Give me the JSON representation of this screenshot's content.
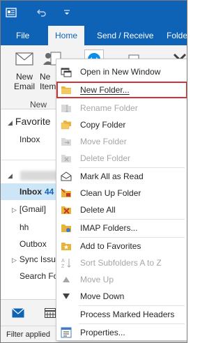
{
  "ribbon_tabs": [
    "File",
    "Home",
    "Send / Receive",
    "Folde"
  ],
  "ribbon_buttons": {
    "new_email_line1": "New",
    "new_email_line2": "Email",
    "new_items_line1": "Ne",
    "new_items_line2": "Item",
    "group_label": "New"
  },
  "nav": {
    "favorites_header": "Favorite",
    "favorites_inbox": "Inbox",
    "inbox_label": "Inbox",
    "inbox_count": "44",
    "gmail": "[Gmail]",
    "hh": "hh",
    "outbox": "Outbox",
    "sync_issues": "Sync Issue",
    "search_folders": "Search Fo"
  },
  "status_text": "Filter applied",
  "context_menu": {
    "items": [
      {
        "label": "Open in New Window",
        "enabled": true,
        "icon": "open-window-icon"
      },
      {
        "label": "New Folder...",
        "enabled": true,
        "icon": "new-folder-icon",
        "highlighted": true
      },
      {
        "label": "Rename Folder",
        "enabled": false,
        "icon": "rename-folder-icon"
      },
      {
        "label": "Copy Folder",
        "enabled": true,
        "icon": "copy-folder-icon"
      },
      {
        "label": "Move Folder",
        "enabled": false,
        "icon": "move-folder-icon"
      },
      {
        "label": "Delete Folder",
        "enabled": false,
        "icon": "delete-folder-icon"
      },
      {
        "label": "Mark All as Read",
        "enabled": true,
        "icon": "mark-read-icon"
      },
      {
        "label": "Clean Up Folder",
        "enabled": true,
        "icon": "clean-up-icon"
      },
      {
        "label": "Delete All",
        "enabled": true,
        "icon": "delete-all-icon"
      },
      {
        "label": "IMAP Folders...",
        "enabled": true,
        "icon": "imap-folders-icon"
      },
      {
        "label": "Add to Favorites",
        "enabled": true,
        "icon": "favorites-star-icon"
      },
      {
        "label": "Sort Subfolders A to Z",
        "enabled": false,
        "icon": "sort-az-icon"
      },
      {
        "label": "Move Up",
        "enabled": false,
        "icon": "arrow-up-icon"
      },
      {
        "label": "Move Down",
        "enabled": true,
        "icon": "arrow-down-icon"
      },
      {
        "label": "Process Marked Headers",
        "enabled": true,
        "icon": ""
      },
      {
        "label": "Properties...",
        "enabled": true,
        "icon": "properties-icon"
      }
    ]
  },
  "colors": {
    "accent": "#0f63b6",
    "highlight_border": "#d13438",
    "folder_yellow": "#e8b33a",
    "disabled_text": "#a6a6a6"
  }
}
